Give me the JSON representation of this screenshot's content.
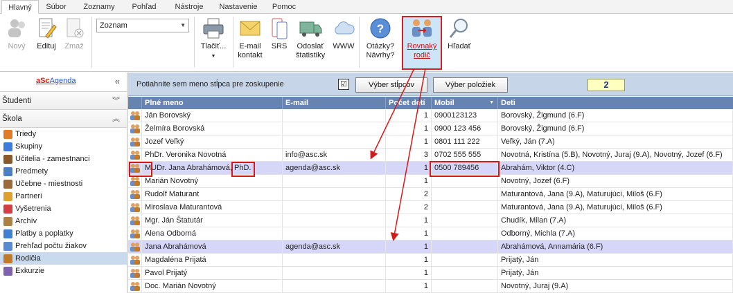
{
  "tabs": [
    "Hlavný",
    "Súbor",
    "Zoznamy",
    "Pohľad",
    "Nástroje",
    "Nastavenie",
    "Pomoc"
  ],
  "ribbon": {
    "new": "Nový",
    "edit": "Edituj",
    "delete": "Zmaž",
    "combo_value": "Zoznam",
    "print": "Tlačiť...",
    "email_l1": "E-mail",
    "email_l2": "kontakt",
    "srs": "SRS",
    "send_l1": "Odoslať",
    "send_l2": "štatistiky",
    "www": "WWW",
    "questions_l1": "Otázky?",
    "questions_l2": "Návrhy?",
    "same_parent_l1": "Rovnaký",
    "same_parent_l2": "rodič",
    "search": "Hľadať"
  },
  "sidebar": {
    "brand_a": "aSc",
    "brand_b": "Agenda",
    "collapse": "«",
    "sec_students": "Študenti",
    "sec_school": "Škola",
    "items": [
      {
        "label": "Triedy",
        "icon": "class-icon",
        "color": "#e07b2a"
      },
      {
        "label": "Skupiny",
        "icon": "groups-icon",
        "color": "#3b7dd8"
      },
      {
        "label": "Učitelia - zamestnanci",
        "icon": "teachers-icon",
        "color": "#8a5a2b"
      },
      {
        "label": "Predmety",
        "icon": "subjects-icon",
        "color": "#4a7fc8"
      },
      {
        "label": "Učebne - miestnosti",
        "icon": "rooms-icon",
        "color": "#9a6a3a"
      },
      {
        "label": "Partneri",
        "icon": "partners-icon",
        "color": "#e0a030"
      },
      {
        "label": "Vyšetrenia",
        "icon": "exams-icon",
        "color": "#d04040"
      },
      {
        "label": "Archív",
        "icon": "archive-icon",
        "color": "#b08040"
      },
      {
        "label": "Platby a poplatky",
        "icon": "payments-icon",
        "color": "#4080d0"
      },
      {
        "label": "Prehľad počtu žiakov",
        "icon": "overview-icon",
        "color": "#5a8ad0"
      },
      {
        "label": "Rodičia",
        "icon": "parents-icon",
        "color": "#c0782a"
      },
      {
        "label": "Exkurzie",
        "icon": "excursions-icon",
        "color": "#8060b0"
      }
    ]
  },
  "toolbar": {
    "group_hint": "Potiahnite sem meno stĺpca pre zoskupenie",
    "check": "☑",
    "columns_btn": "Výber stĺpcov",
    "items_btn": "Výber položiek",
    "count": "2"
  },
  "table": {
    "headers": [
      "Plné meno",
      "E-mail",
      "Počet detí",
      "Mobil",
      "Deti"
    ],
    "rows": [
      {
        "name": "Ján Borovský",
        "email": "",
        "count": "1",
        "mobile": "0900123123",
        "kids": "Borovský, Žigmund (6.F)"
      },
      {
        "name": "Želmíra Borovská",
        "email": "",
        "count": "1",
        "mobile": "0900 123 456",
        "kids": "Borovský, Žigmund (6.F)"
      },
      {
        "name": "Jozef Veľký",
        "email": "",
        "count": "1",
        "mobile": "0801 111 222",
        "kids": "Veľký, Ján (7.A)"
      },
      {
        "name": "PhDr. Veronika Novotná",
        "email": "info@asc.sk",
        "count": "3",
        "mobile": "0702 555 555",
        "kids": "Novotná, Kristína (5.B), Novotný, Juraj (9.A), Novotný, Jozef (6.F)"
      },
      {
        "name": "MUDr. Jana Abrahámová, PhD.",
        "email": "agenda@asc.sk",
        "count": "1",
        "mobile": "0500 789456",
        "kids": "Abrahám, Viktor (4.C)"
      },
      {
        "name": "Marián Novotný",
        "email": "",
        "count": "1",
        "mobile": "",
        "kids": "Novotný, Jozef (6.F)"
      },
      {
        "name": "Rudolf Maturant",
        "email": "",
        "count": "2",
        "mobile": "",
        "kids": "Maturantová, Jana (9.A), Maturujúci, Miloš (6.F)"
      },
      {
        "name": "Miroslava Maturantová",
        "email": "",
        "count": "2",
        "mobile": "",
        "kids": "Maturantová, Jana (9.A), Maturujúci, Miloš (6.F)"
      },
      {
        "name": "Mgr. Ján Štatutár",
        "email": "",
        "count": "1",
        "mobile": "",
        "kids": "Chudík, Milan (7.A)"
      },
      {
        "name": "Alena Odborná",
        "email": "",
        "count": "1",
        "mobile": "",
        "kids": "Odborný, Michla (7.A)"
      },
      {
        "name": "Jana Abrahámová",
        "email": "agenda@asc.sk",
        "count": "1",
        "mobile": "",
        "kids": "Abrahámová, Annamária (6.F)"
      },
      {
        "name": "Magdaléna Prijatá",
        "email": "",
        "count": "1",
        "mobile": "",
        "kids": "Prijatý, Ján"
      },
      {
        "name": "Pavol Prijatý",
        "email": "",
        "count": "1",
        "mobile": "",
        "kids": "Prijatý, Ján"
      },
      {
        "name": "Doc. Marián Novotný",
        "email": "",
        "count": "1",
        "mobile": "",
        "kids": "Novotný, Juraj (9.A)"
      }
    ]
  }
}
